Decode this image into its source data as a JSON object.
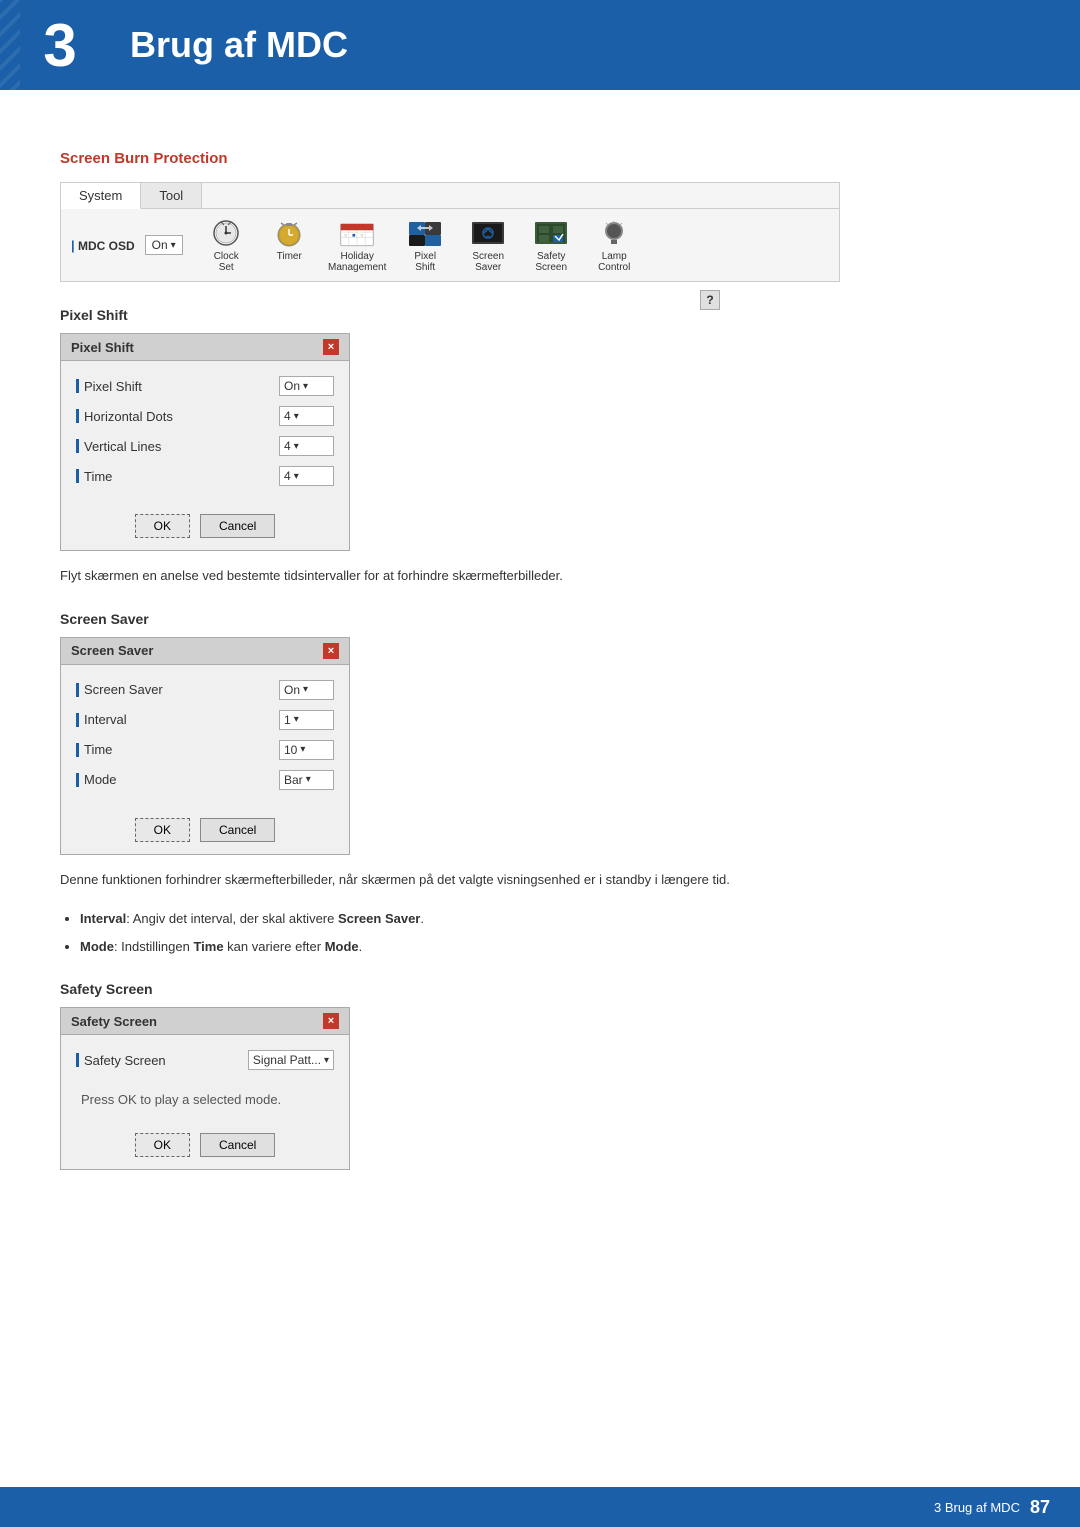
{
  "header": {
    "chapter_number": "3",
    "title": "Brug af MDC"
  },
  "screen_burn": {
    "section_title": "Screen Burn Protection",
    "toolbar": {
      "tabs": [
        "System",
        "Tool"
      ],
      "active_tab": "System",
      "mdc_osd_label": "MDC OSD",
      "mdc_osd_value": "On",
      "question_label": "?",
      "items": [
        {
          "label": "Clock\nSet",
          "lines": [
            "Clock",
            "Set"
          ]
        },
        {
          "label": "Timer"
        },
        {
          "label": "Holiday\nManagement",
          "lines": [
            "Holiday",
            "Management"
          ]
        },
        {
          "label": "Pixel\nShift",
          "lines": [
            "Pixel",
            "Shift"
          ]
        },
        {
          "label": "Screen\nSaver",
          "lines": [
            "Screen",
            "Saver"
          ]
        },
        {
          "label": "Safety\nScreen",
          "lines": [
            "Safety",
            "Screen"
          ]
        },
        {
          "label": "Lamp\nControl",
          "lines": [
            "Lamp",
            "Control"
          ]
        }
      ]
    }
  },
  "pixel_shift": {
    "subsection_title": "Pixel Shift",
    "dialog_title": "Pixel Shift",
    "close_btn": "×",
    "rows": [
      {
        "label": "Pixel Shift",
        "value": "On",
        "has_arrow": true
      },
      {
        "label": "Horizontal Dots",
        "value": "4",
        "has_arrow": true
      },
      {
        "label": "Vertical Lines",
        "value": "4",
        "has_arrow": true
      },
      {
        "label": "Time",
        "value": "4",
        "has_arrow": true
      }
    ],
    "ok_label": "OK",
    "cancel_label": "Cancel",
    "description": "Flyt skærmen en anelse ved bestemte tidsintervaller for at forhindre skærmefterbilleder."
  },
  "screen_saver": {
    "subsection_title": "Screen Saver",
    "dialog_title": "Screen Saver",
    "close_btn": "×",
    "rows": [
      {
        "label": "Screen Saver",
        "value": "On",
        "has_arrow": true
      },
      {
        "label": "Interval",
        "value": "1",
        "has_arrow": true
      },
      {
        "label": "Time",
        "value": "10",
        "has_arrow": true
      },
      {
        "label": "Mode",
        "value": "Bar",
        "has_arrow": true
      }
    ],
    "ok_label": "OK",
    "cancel_label": "Cancel",
    "description": "Denne funktionen forhindrer skærmefterbilleder, når skærmen på det valgte visningsenhed er i standby i længere tid.",
    "bullets": [
      {
        "term": "Interval",
        "colon": ": ",
        "before": "",
        "text": "Angiv det interval, der skal aktivere ",
        "bold": "Screen Saver",
        "after": "."
      },
      {
        "term": "Mode",
        "colon": ": ",
        "before": "",
        "text": "Indstillingen ",
        "bold": "Time",
        "middle": " kan variere efter ",
        "bold2": "Mode",
        "after": "."
      }
    ]
  },
  "safety_screen": {
    "subsection_title": "Safety Screen",
    "dialog_title": "Safety Screen",
    "close_btn": "×",
    "rows": [
      {
        "label": "Safety Screen",
        "value": "Signal Patt...",
        "has_arrow": true
      }
    ],
    "note_text": "Press OK to play a selected mode.",
    "ok_label": "OK",
    "cancel_label": "Cancel"
  },
  "footer": {
    "text": "3 Brug af MDC",
    "page": "87"
  }
}
